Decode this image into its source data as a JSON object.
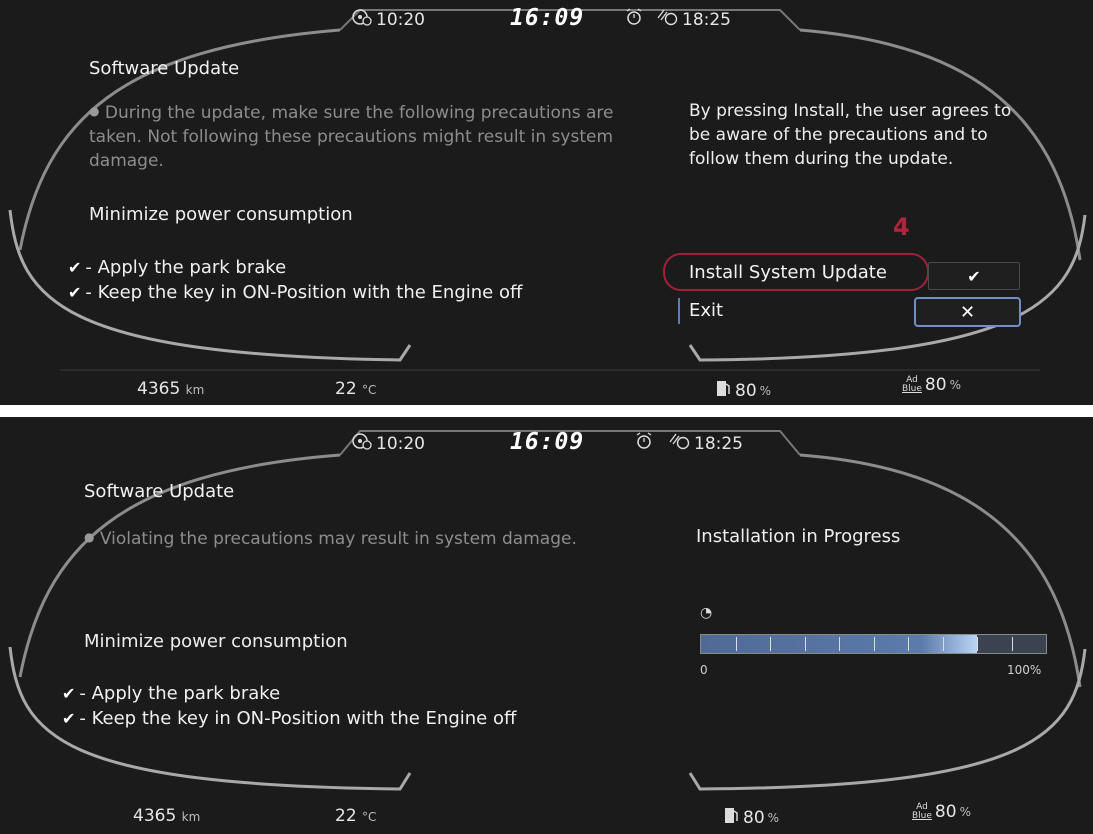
{
  "screens": [
    {
      "header": {
        "trip_time": "10:20",
        "clock": "16:09",
        "alarm_time": "18:25"
      },
      "title": "Software Update",
      "warning": "During the update, make sure the following precautions are taken. Not following these precautions might result in system damage.",
      "agreement": "By pressing Install, the user agrees to be aware of the precautions and to follow them during the update.",
      "subheading": "Minimize power consumption",
      "checklist": [
        "- Apply the park brake",
        "- Keep the key in ON-Position with the Engine off"
      ],
      "step_marker": "4",
      "install_label": "Install System Update",
      "exit_label": "Exit",
      "footer": {
        "odometer": "4365",
        "odometer_unit": "km",
        "temperature": "22",
        "temperature_unit": "°C",
        "fuel": "80",
        "fuel_unit": "%",
        "adblue_label_top": "Ad",
        "adblue_label_bottom": "Blue",
        "adblue": "80",
        "adblue_unit": "%"
      }
    },
    {
      "header": {
        "trip_time": "10:20",
        "clock": "16:09",
        "alarm_time": "18:25"
      },
      "title": "Software Update",
      "warning": "Violating the precautions may result in system damage.",
      "status": "Installation in Progress",
      "subheading": "Minimize power consumption",
      "checklist": [
        "- Apply the park brake",
        "- Keep the key in ON-Position with the Engine off"
      ],
      "progress": {
        "value_fraction": 0.8,
        "min_label": "0",
        "max_label": "100%",
        "segments": 10
      },
      "footer": {
        "odometer": "4365",
        "odometer_unit": "km",
        "temperature": "22",
        "temperature_unit": "°C",
        "fuel": "80",
        "fuel_unit": "%",
        "adblue_label_top": "Ad",
        "adblue_label_bottom": "Blue",
        "adblue": "80",
        "adblue_unit": "%"
      }
    }
  ],
  "colors": {
    "background": "#1b1b1c",
    "bezel_highlight": "#9a9a9a",
    "accent_blue": "#6f8fc6",
    "marker_red": "#a1213a",
    "warning_text": "#8d8d8d"
  }
}
